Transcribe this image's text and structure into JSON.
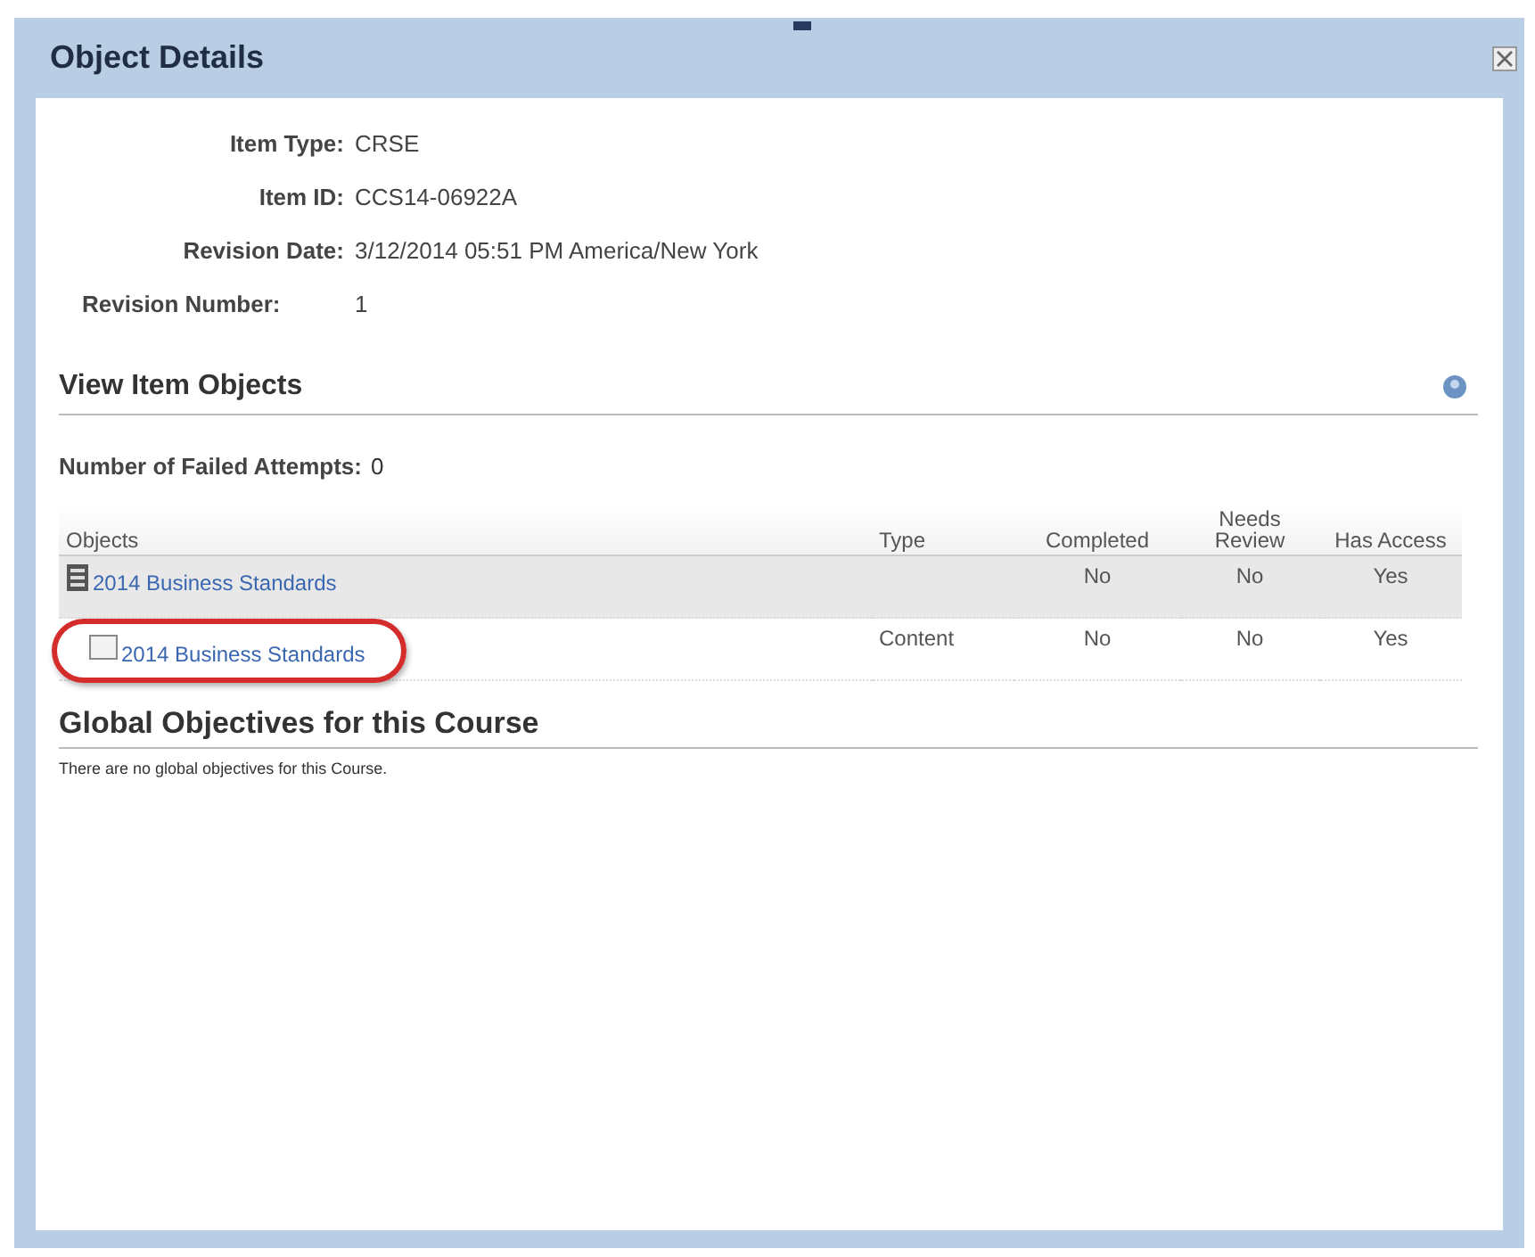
{
  "window": {
    "title": "Object Details"
  },
  "details": [
    {
      "label": "Item Type:",
      "value": "CRSE"
    },
    {
      "label": "Item ID:",
      "value": "CCS14-06922A"
    },
    {
      "label": "Revision Date:",
      "value": "3/12/2014 05:51 PM America/New York"
    },
    {
      "label": "Revision Number:",
      "value": "1"
    }
  ],
  "view_item_objects": {
    "title": "View Item Objects",
    "failed_attempts": {
      "label": "Number of Failed Attempts:",
      "value": "0"
    },
    "table": {
      "columns": [
        "Objects",
        "Type",
        "Completed",
        "Needs Review",
        "Has Access"
      ],
      "rows": [
        {
          "kind": "course",
          "name": "2014 Business Standards",
          "type": "",
          "completed": "No",
          "needs_review": "No",
          "has_access": "Yes",
          "selected": true,
          "circled": false
        },
        {
          "kind": "content",
          "name": "2014 Business Standards",
          "type": "Content",
          "completed": "No",
          "needs_review": "No",
          "has_access": "Yes",
          "selected": false,
          "circled": true
        }
      ]
    }
  },
  "global_objectives": {
    "title": "Global Objectives for this Course",
    "message": "There are no global objectives for this Course."
  }
}
